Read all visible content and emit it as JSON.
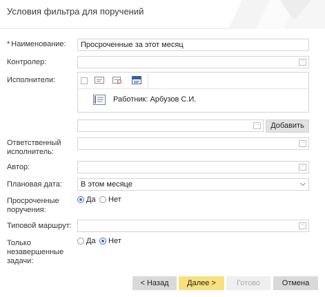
{
  "dialog": {
    "title": "Условия фильтра для поручений"
  },
  "form": {
    "name": {
      "required_mark": "*",
      "label": "Наименование:",
      "value": "Просроченные за этот месяц"
    },
    "controller": {
      "label": "Контролер:",
      "value": ""
    },
    "executors": {
      "label": "Исполнители:",
      "toolbar_icons": [
        "checkbox",
        "card-icon",
        "card-search-icon",
        "abc-list-icon"
      ],
      "items": [
        {
          "icon": "employee-card-icon",
          "name": "Работник: Арбузов С.И."
        }
      ],
      "add_value": "",
      "add_button": "Добавить"
    },
    "responsible": {
      "label_line1": "Ответственный",
      "label_line2": "исполнитель:",
      "value": ""
    },
    "author": {
      "label": "Автор:",
      "value": ""
    },
    "planned_date": {
      "label": "Плановая дата:",
      "value": "В этом месяце"
    },
    "overdue": {
      "label_line1": "Просроченные",
      "label_line2": "поручения:",
      "options": [
        {
          "label": "Да",
          "selected": true
        },
        {
          "label": "Нет",
          "selected": false
        }
      ]
    },
    "route": {
      "label": "Типовой маршрут:",
      "value": ""
    },
    "unfinished": {
      "label_line1": "Только",
      "label_line2": "незавершенные",
      "label_line3": "задачи:",
      "options": [
        {
          "label": "Да",
          "selected": false
        },
        {
          "label": "Нет",
          "selected": true
        }
      ]
    },
    "ellipsis": "···"
  },
  "footer": {
    "back": "< Назад",
    "next": "Далее >",
    "done": "Готово",
    "cancel": "Отмена"
  },
  "colors": {
    "accent_yellow": "#f7e07d",
    "radio_blue": "#3b6fc4",
    "border": "#d4d4d4"
  }
}
